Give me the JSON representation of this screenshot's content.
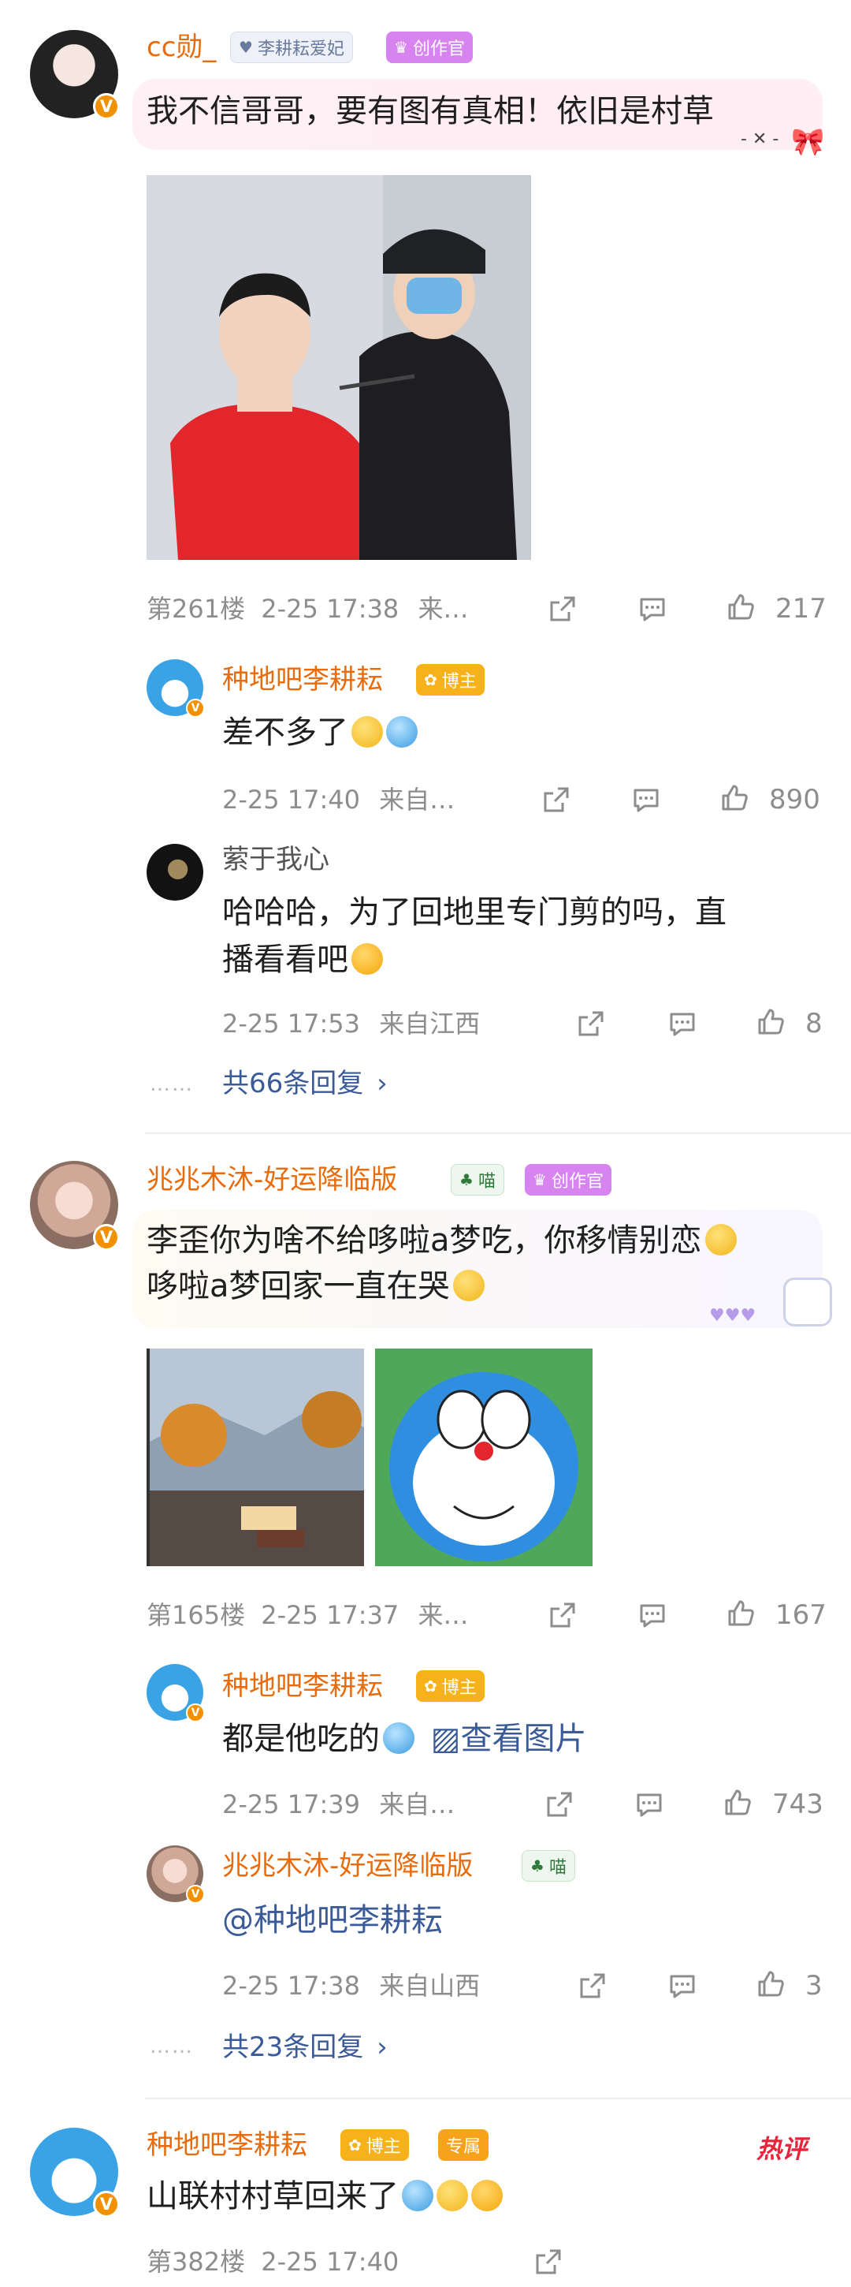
{
  "comment1": {
    "username": "cc勋_",
    "fan_badge": "李耕耘爱妃",
    "creator_badge": "创作官",
    "text": "我不信哥哥，要有图有真相！依旧是村草",
    "bubble_deco": "- ✕ -",
    "floor": "第261楼",
    "time": "2-25 17:38",
    "source": "来…",
    "likes": "217",
    "replies": [
      {
        "username": "种地吧李耕耘",
        "badge": "博主",
        "text": "差不多了",
        "time": "2-25 17:40",
        "source": "来自…",
        "likes": "890"
      },
      {
        "username": "萦于我心",
        "text_line1": "哈哈哈，为了回地里专门剪的吗，直",
        "text_line2": "播看看吧",
        "time": "2-25 17:53",
        "source": "来自江西",
        "likes": "8"
      }
    ],
    "more_replies": "共66条回复",
    "dots": "……"
  },
  "comment2": {
    "username": "兆兆木沐-好运降临版",
    "fan_badge": "喵",
    "creator_badge": "创作官",
    "text_line1": "李歪你为啥不给哆啦a梦吃，你移情别恋",
    "text_line2": "哆啦a梦回家一直在哭",
    "floor": "第165楼",
    "time": "2-25 17:37",
    "source": "来…",
    "likes": "167",
    "replies": [
      {
        "username": "种地吧李耕耘",
        "badge": "博主",
        "text": "都是他吃的",
        "view_image": "查看图片",
        "time": "2-25 17:39",
        "source": "来自…",
        "likes": "743"
      },
      {
        "username": "兆兆木沐-好运降临版",
        "badge": "喵",
        "text": "@种地吧李耕耘",
        "time": "2-25 17:38",
        "source": "来自山西",
        "likes": "3"
      }
    ],
    "more_replies": "共23条回复",
    "dots": "……"
  },
  "comment3": {
    "username": "种地吧李耕耘",
    "badge": "博主",
    "exclusive_badge": "专属",
    "hot_badge": "热评",
    "text": "山联村村草回来了",
    "floor": "第382楼",
    "time": "2-25 17:40"
  },
  "colors": {
    "username": "#e86b0c",
    "meta": "#8d8d8d",
    "link": "#3b5b98"
  }
}
